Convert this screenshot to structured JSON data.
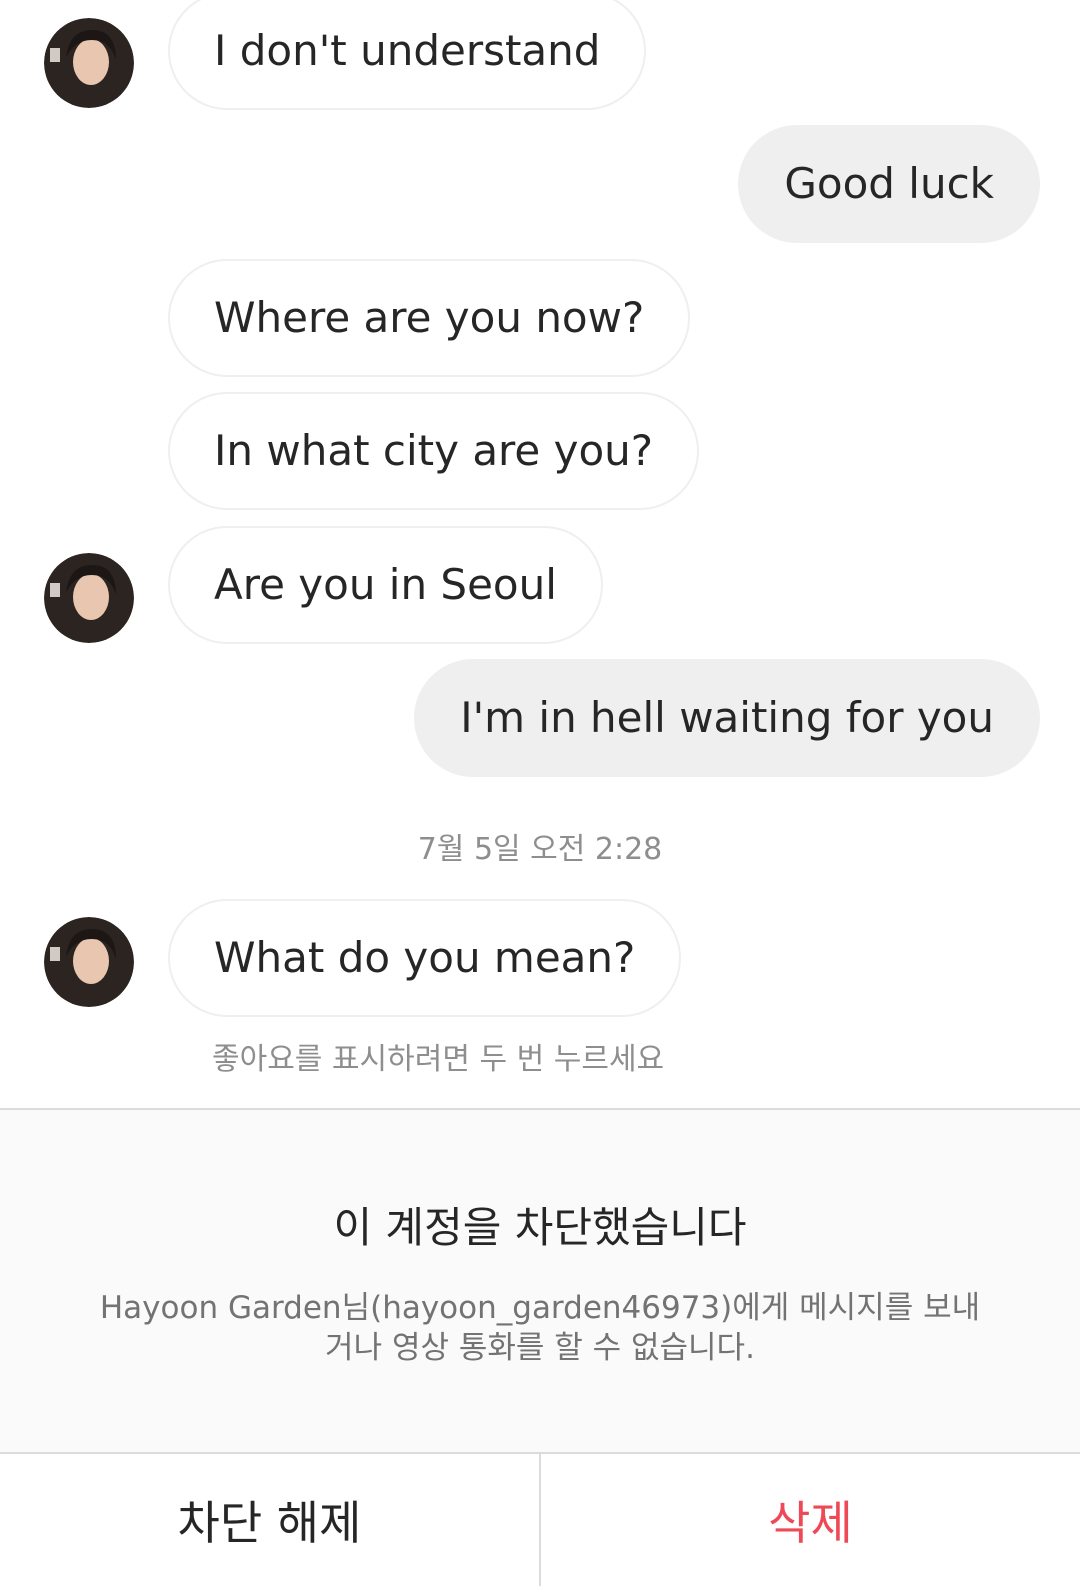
{
  "messages": [
    {
      "text": "I don't understand"
    },
    {
      "text": "Good luck"
    },
    {
      "text": "Where are you now?"
    },
    {
      "text": "In what city are you?"
    },
    {
      "text": "Are you in Seoul"
    },
    {
      "text": "I'm in hell waiting for you"
    },
    {
      "text": "What do you mean?"
    }
  ],
  "timestamp": "7월 5일 오전 2:28",
  "like_hint": "좋아요를 표시하려면 두 번 누르세요",
  "blocked": {
    "title": "이 계정을 차단했습니다",
    "description": "Hayoon Garden님(hayoon_garden46973)에게 메시지를 보내거나 영상 통화를 할 수 없습니다."
  },
  "actions": {
    "unblock_label": "차단 해제",
    "delete_label": "삭제"
  },
  "colors": {
    "delete": "#ed4956",
    "outgoing_bubble": "#efefef",
    "muted_text": "#8e8e8e"
  }
}
